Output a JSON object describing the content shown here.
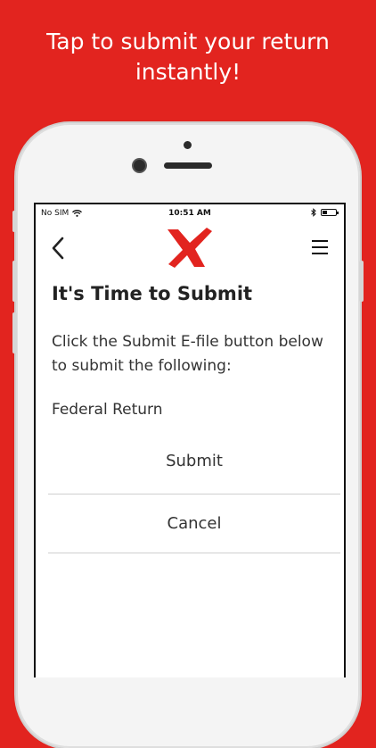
{
  "promo": {
    "line1": "Tap to submit your return",
    "line2": "instantly!"
  },
  "status_bar": {
    "carrier": "No SIM",
    "time": "10:51 AM"
  },
  "nav": {
    "back_icon": "chevron-left-icon",
    "logo_icon": "brand-x-logo",
    "menu_icon": "hamburger-menu-icon"
  },
  "page": {
    "title": "It's Time to Submit",
    "instruction": "Click the Submit E-file button below to submit the following:",
    "return_type": "Federal Return"
  },
  "actions": {
    "submit_label": "Submit",
    "cancel_label": "Cancel"
  },
  "colors": {
    "brand_red": "#e2241f",
    "text_dark": "#222222"
  }
}
